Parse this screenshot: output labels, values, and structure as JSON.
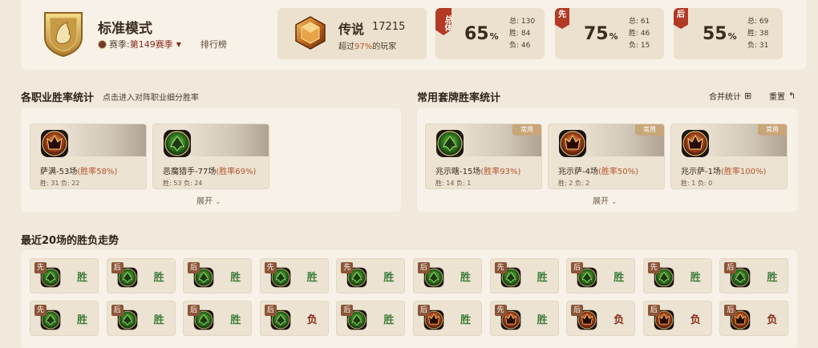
{
  "header": {
    "mode_title": "标准模式",
    "season_label": "赛季:",
    "season_value": "第149赛季",
    "rank_link": "排行榜",
    "rank": {
      "name": "传说",
      "number": "17215",
      "desc_prefix": "超过",
      "percent": "97%",
      "desc_suffix": "的玩家"
    },
    "stats": [
      {
        "tag": "总体",
        "value": "65",
        "unit": "%",
        "total": "总: 130",
        "win": "胜: 84",
        "loss": "负: 46"
      },
      {
        "tag": "先",
        "value": "75",
        "unit": "%",
        "total": "总: 61",
        "win": "胜: 46",
        "loss": "负: 15"
      },
      {
        "tag": "后",
        "value": "55",
        "unit": "%",
        "total": "总: 69",
        "win": "胜: 38",
        "loss": "负: 31"
      }
    ]
  },
  "class_stats": {
    "title": "各职业胜率统计",
    "subtitle": "点击进入对阵职业细分胜率",
    "expand": "展开",
    "cards": [
      {
        "name": "萨满-53场",
        "rate": "(胜率58%)",
        "wl": "胜: 31 负: 22",
        "icon": "shaman-icon"
      },
      {
        "name": "恶魔猎手-77场",
        "rate": "(胜率69%)",
        "wl": "胜: 53 负: 24",
        "icon": "demon-hunter-icon"
      }
    ]
  },
  "deck_stats": {
    "title": "常用套牌胜率统计",
    "merge": "合并统计",
    "reset": "重置",
    "expand": "展开",
    "cards": [
      {
        "name": "兆示瞎-15场",
        "rate": "(胜率93%)",
        "wl": "胜: 14 负: 1",
        "badge": "常用",
        "icon": "demon-hunter-icon"
      },
      {
        "name": "兆示萨-4场",
        "rate": "(胜率50%)",
        "wl": "胜: 2 负: 2",
        "badge": "常用",
        "icon": "shaman-icon"
      },
      {
        "name": "兆示萨-1场",
        "rate": "(胜率100%)",
        "wl": "胜: 1 负: 0",
        "badge": "常用",
        "icon": "shaman-icon"
      }
    ]
  },
  "recent": {
    "title": "最近20场的胜负走势",
    "games": [
      {
        "pos": "先",
        "result": "胜",
        "hero": "demon-hunter-icon"
      },
      {
        "pos": "后",
        "result": "胜",
        "hero": "demon-hunter-icon"
      },
      {
        "pos": "后",
        "result": "胜",
        "hero": "demon-hunter-icon"
      },
      {
        "pos": "先",
        "result": "胜",
        "hero": "demon-hunter-icon"
      },
      {
        "pos": "先",
        "result": "胜",
        "hero": "demon-hunter-icon"
      },
      {
        "pos": "后",
        "result": "胜",
        "hero": "demon-hunter-icon"
      },
      {
        "pos": "先",
        "result": "胜",
        "hero": "demon-hunter-icon"
      },
      {
        "pos": "后",
        "result": "胜",
        "hero": "demon-hunter-icon"
      },
      {
        "pos": "先",
        "result": "胜",
        "hero": "demon-hunter-icon"
      },
      {
        "pos": "后",
        "result": "胜",
        "hero": "demon-hunter-icon"
      },
      {
        "pos": "先",
        "result": "胜",
        "hero": "demon-hunter-icon"
      },
      {
        "pos": "后",
        "result": "胜",
        "hero": "demon-hunter-icon"
      },
      {
        "pos": "后",
        "result": "胜",
        "hero": "demon-hunter-icon"
      },
      {
        "pos": "后",
        "result": "负",
        "hero": "demon-hunter-icon"
      },
      {
        "pos": "后",
        "result": "胜",
        "hero": "demon-hunter-icon"
      },
      {
        "pos": "后",
        "result": "胜",
        "hero": "shaman-icon"
      },
      {
        "pos": "先",
        "result": "胜",
        "hero": "shaman-icon"
      },
      {
        "pos": "后",
        "result": "负",
        "hero": "shaman-icon"
      },
      {
        "pos": "后",
        "result": "负",
        "hero": "shaman-icon"
      },
      {
        "pos": "后",
        "result": "负",
        "hero": "shaman-icon"
      }
    ]
  },
  "colors": {
    "accent": "#b33a24",
    "win": "#3f7d3a",
    "loss": "#8a2b1a",
    "rate": "#b4552c"
  }
}
